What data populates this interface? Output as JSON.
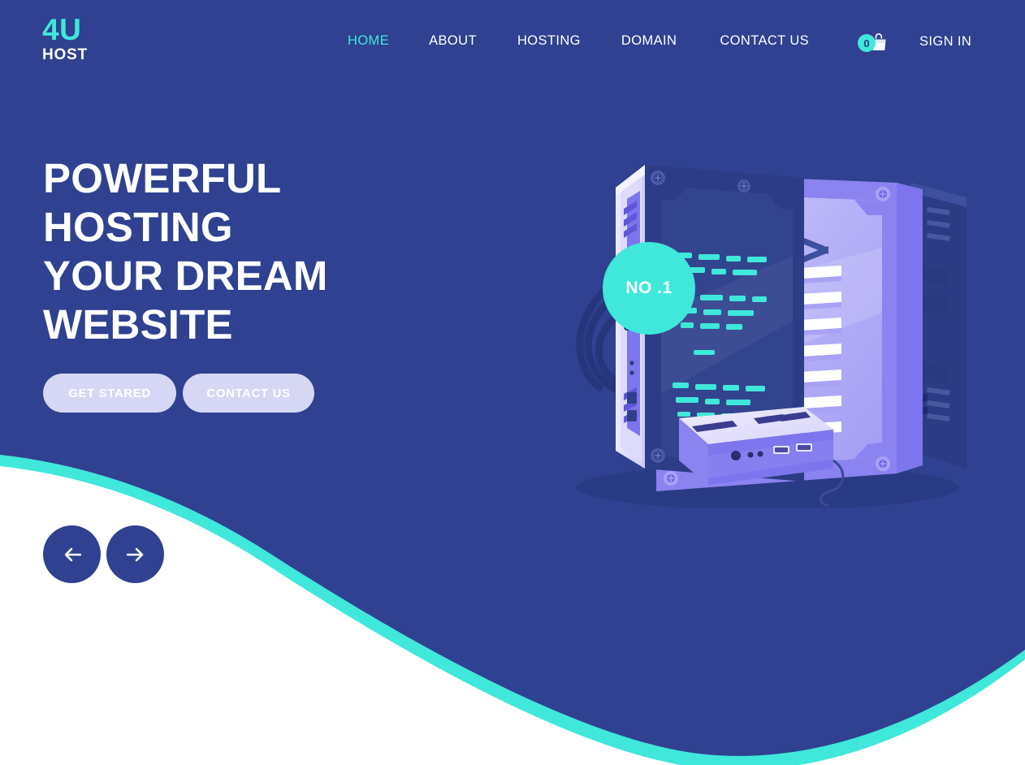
{
  "brand": {
    "line1": "4U",
    "line2": "HOST",
    "accent_color": "#3fe8da"
  },
  "nav": {
    "items": [
      {
        "label": "HOME",
        "active": true
      },
      {
        "label": "ABOUT",
        "active": false
      },
      {
        "label": "HOSTING",
        "active": false
      },
      {
        "label": "DOMAIN",
        "active": false
      },
      {
        "label": "CONTACT US",
        "active": false
      }
    ]
  },
  "cart": {
    "count": "0",
    "icon": "shopping-bag-icon"
  },
  "account": {
    "signin_label": "SIGN IN"
  },
  "hero": {
    "title_lines": [
      "POWERFUL",
      "HOSTING",
      "YOUR DREAM",
      "WEBSITE"
    ],
    "primary_button": "GET STARED",
    "secondary_button": "CONTACT US",
    "badge": "NO .1"
  },
  "slider": {
    "prev_icon": "arrow-left-icon",
    "next_icon": "arrow-right-icon"
  },
  "theme": {
    "background_blue": "#2f4190",
    "accent_cyan": "#3fe8da",
    "button_lavender": "#d5d7f4",
    "white": "#ffffff"
  }
}
